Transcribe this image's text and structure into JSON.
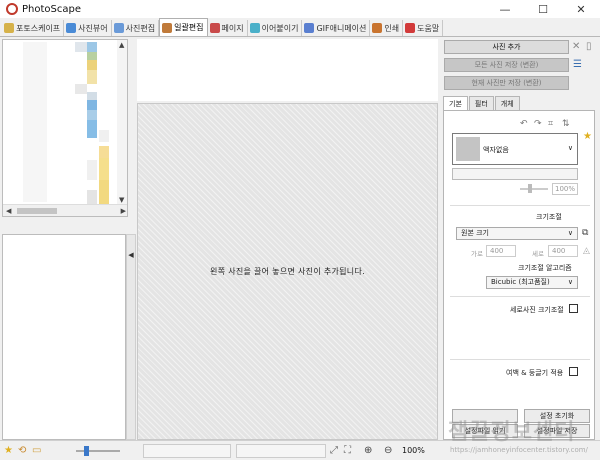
{
  "window": {
    "title": "PhotoScape",
    "controls": [
      "minimize",
      "maximize",
      "close"
    ]
  },
  "tabs": [
    {
      "label": "포토스케이프",
      "color": "#d6b24a",
      "active": false
    },
    {
      "label": "사진뷰어",
      "color": "#4a8bd6",
      "active": false
    },
    {
      "label": "사진편집",
      "color": "#6a9ad8",
      "active": false
    },
    {
      "label": "일괄편집",
      "color": "#c07a3a",
      "active": true
    },
    {
      "label": "페이지",
      "color": "#c94a4a",
      "active": false
    },
    {
      "label": "이어붙이기",
      "color": "#4ab0c9",
      "active": false
    },
    {
      "label": "GIF애니메이션",
      "color": "#5a7fd0",
      "active": false
    },
    {
      "label": "인쇄",
      "color": "#c9742f",
      "active": false
    },
    {
      "label": "도움말",
      "color": "#d23a3a",
      "active": false
    }
  ],
  "canvas": {
    "drop_hint": "왼쪽 사진을 끌어 놓으면 사진이 추가됩니다."
  },
  "right_panel": {
    "add_photo": "사진 추가",
    "save_all": "모든 사진 저장 (변환)",
    "save_current": "현재 사진만 저장 (변환)",
    "subtabs": [
      "기본",
      "필터",
      "개체"
    ],
    "frame_value": "액자없음",
    "frame_percent": "100%",
    "resize_label": "크기조절",
    "resize_value": "원본 크기",
    "width_label": "가로",
    "width_value": "400",
    "height_label": "세로",
    "height_value": "400",
    "algorithm_label": "크기조절 알고리즘",
    "algorithm_value": "Bicubic (최고품질)",
    "portrait_resize": "세로사진 크기조절",
    "margin_fill": "여백 & 둥글기 적용",
    "reset_settings": "설정 초기화",
    "load_settings": "설정파일 읽기",
    "save_settings": "설정파일 저장"
  },
  "statusbar": {
    "zoom": "100%"
  },
  "watermark": {
    "text": "잼꿀정보센터",
    "url": "https://jamhoneyinfocenter.tistory.com/"
  }
}
